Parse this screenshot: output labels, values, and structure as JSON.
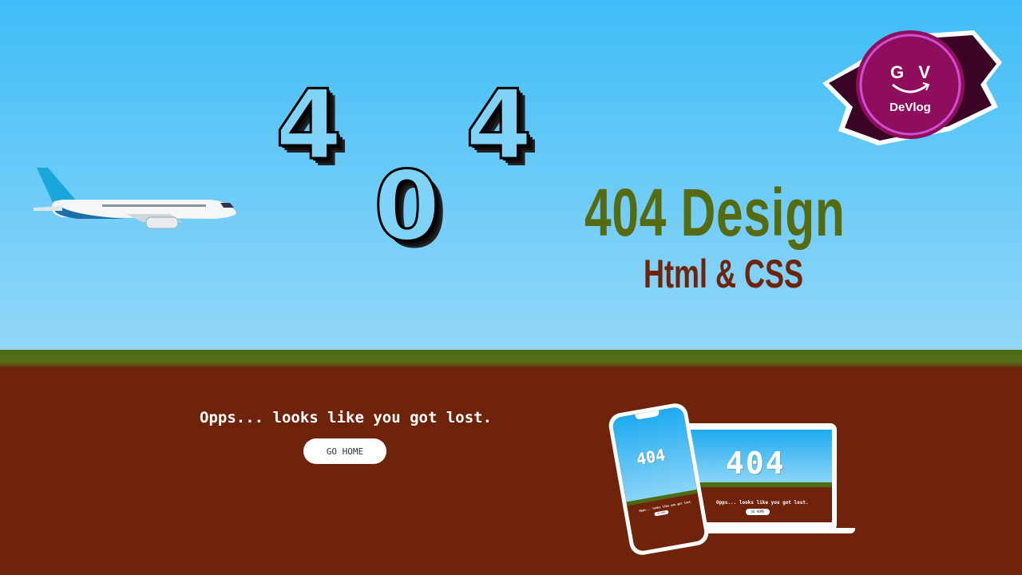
{
  "hero": {
    "digits": [
      "4",
      "0",
      "4"
    ],
    "title": "404 Design",
    "subtitle": "Html & CSS"
  },
  "logo": {
    "letters": "G   V",
    "name": "DeVlog"
  },
  "page": {
    "message": "Opps... looks like you got lost.",
    "button_label": "GO HOME"
  },
  "mockup": {
    "laptop_code": "404",
    "phone_code": "404",
    "message": "Opps... looks like you got lost.",
    "button_label": "GO HOME"
  },
  "colors": {
    "sky": "#3fbdf8",
    "grass": "#4d6a14",
    "ground": "#6e230a",
    "title": "#566a10",
    "subtitle": "#6e230a"
  }
}
